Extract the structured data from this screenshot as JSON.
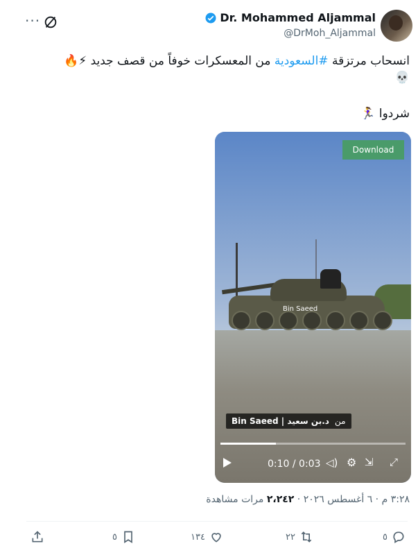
{
  "header": {
    "name": "Dr. Mohammed Aljammal",
    "handle": "@DrMoh_Aljammal"
  },
  "tweet": {
    "line1_before": "انسحاب مرتزقة ",
    "hashtag": "#السعودية",
    "line1_after": " من المعسكرات خوفاً من قصف جديد ⚡🔥",
    "line1_emoji": "💀",
    "line2": "شردوا 🏃‍♀️"
  },
  "video": {
    "download_label": "Download",
    "watermark": "Bin Saeed",
    "caption_bold": "Bin Saeed | د.بن سعيد",
    "caption_prefix": "من",
    "time": "0:10 / 0:03",
    "progress": 0.3
  },
  "meta": {
    "time": "٣:٢٨ م",
    "date": "٦ أغسطس ٢٠٢٦",
    "views_count": "٢،٢٤٢",
    "views_label": "مرات مشاهدة"
  },
  "actions": {
    "replies": "٥",
    "reposts": "٢٢",
    "likes": "١٣٤",
    "bookmarks": "٥"
  },
  "colors": {
    "accent": "#1d9bf0",
    "secondary_text": "#536471",
    "download_button": "#4a9b6a"
  }
}
